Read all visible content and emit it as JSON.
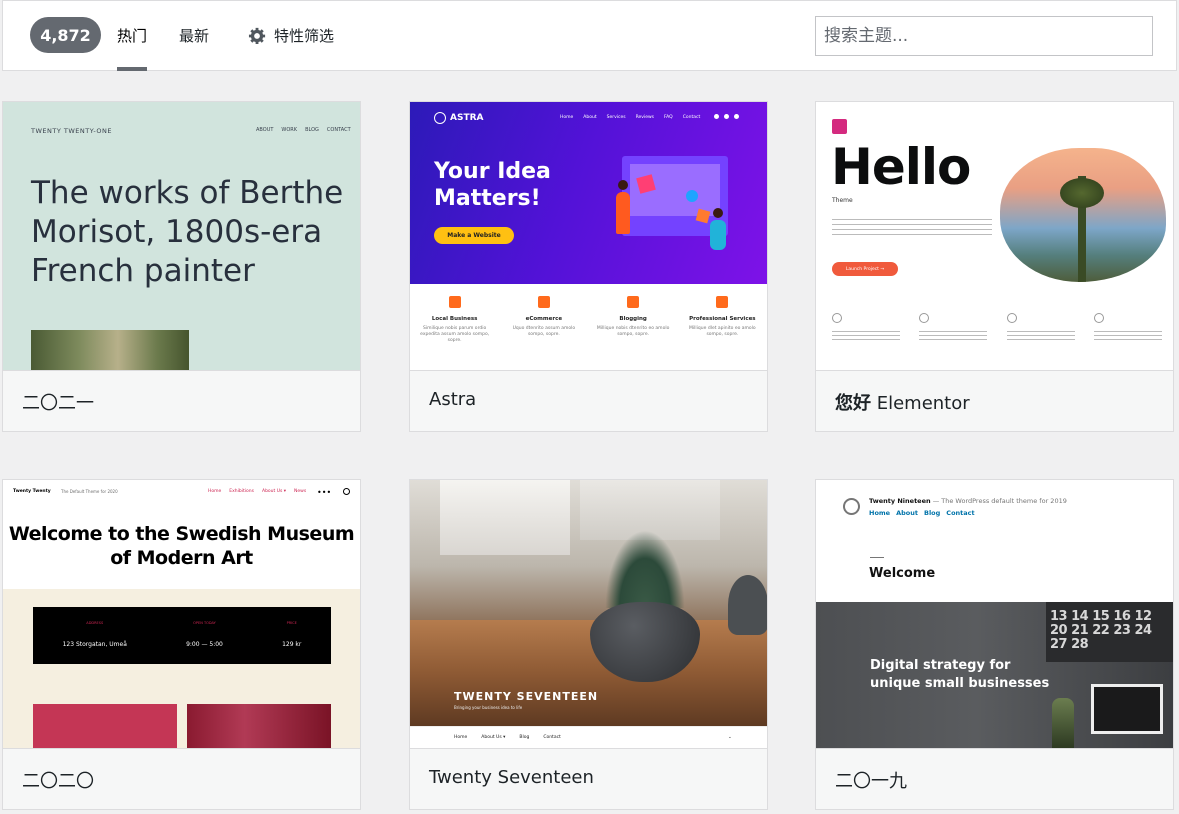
{
  "filter_bar": {
    "count": "4,872",
    "tabs": [
      {
        "label": "热门",
        "active": true
      },
      {
        "label": "最新",
        "active": false
      },
      {
        "label": "特性筛选",
        "active": false,
        "icon": "gear-icon"
      }
    ],
    "search": {
      "placeholder": "搜索主题...",
      "value": ""
    }
  },
  "themes": [
    {
      "name": "二〇二一",
      "preview": {
        "brand": "TWENTY TWENTY-ONE",
        "nav": [
          "ABOUT",
          "WORK",
          "BLOG",
          "CONTACT"
        ],
        "headline": "The works of Berthe Morisot, 1800s-era French painter"
      }
    },
    {
      "name": "Astra",
      "preview": {
        "logo": "ASTRA",
        "nav": [
          "Home",
          "About",
          "Services",
          "Reviews",
          "FAQ",
          "Contact"
        ],
        "headline": "Your Idea Matters!",
        "cta": "Make a Website",
        "features": [
          {
            "title": "Local Business",
            "text": "Similique nobis parum ordio expedita assum amolo sompo, sopre."
          },
          {
            "title": "eCommerce",
            "text": "Uquo dtenrito assum amolo sompo, sopre."
          },
          {
            "title": "Blogging",
            "text": "Millique nobis dtenrito eo amolo sompo, sopre."
          },
          {
            "title": "Professional Services",
            "text": "Millique dlet apinito eo amolo sompo, sopre."
          }
        ]
      }
    },
    {
      "name_bold": "您好",
      "name_rest": " Elementor",
      "preview": {
        "headline": "Hello",
        "sub": "Theme",
        "cta": "Launch Project →"
      }
    },
    {
      "name": "二〇二〇",
      "preview": {
        "brand": "Twenty Twenty",
        "tagline": "The Default Theme for 2020",
        "nav": [
          "Home",
          "Exhibitions",
          "About Us ▾",
          "News"
        ],
        "headline": "Welcome to the Swedish Museum of Modern Art",
        "info": [
          {
            "label": "ADDRESS",
            "value": "123 Storgatan, Umeå"
          },
          {
            "label": "OPEN TODAY",
            "value": "9:00 — 5:00"
          },
          {
            "label": "PRICE",
            "value": "129 kr"
          }
        ]
      }
    },
    {
      "name": "Twenty Seventeen",
      "preview": {
        "title": "TWENTY SEVENTEEN",
        "tagline": "Bringing your business idea to life",
        "nav": [
          "Home",
          "About Us ▾",
          "Blog",
          "Contact"
        ]
      }
    },
    {
      "name": "二〇一九",
      "preview": {
        "site": "Twenty Nineteen",
        "tagline": "— The WordPress default theme for 2019",
        "nav": [
          "Home",
          "About",
          "Blog",
          "Contact"
        ],
        "welcome": "Welcome",
        "hero_text": "Digital strategy for unique small businesses",
        "calendar": "13 14 15 16 12 20 21 22 23 24 27 28"
      }
    }
  ]
}
